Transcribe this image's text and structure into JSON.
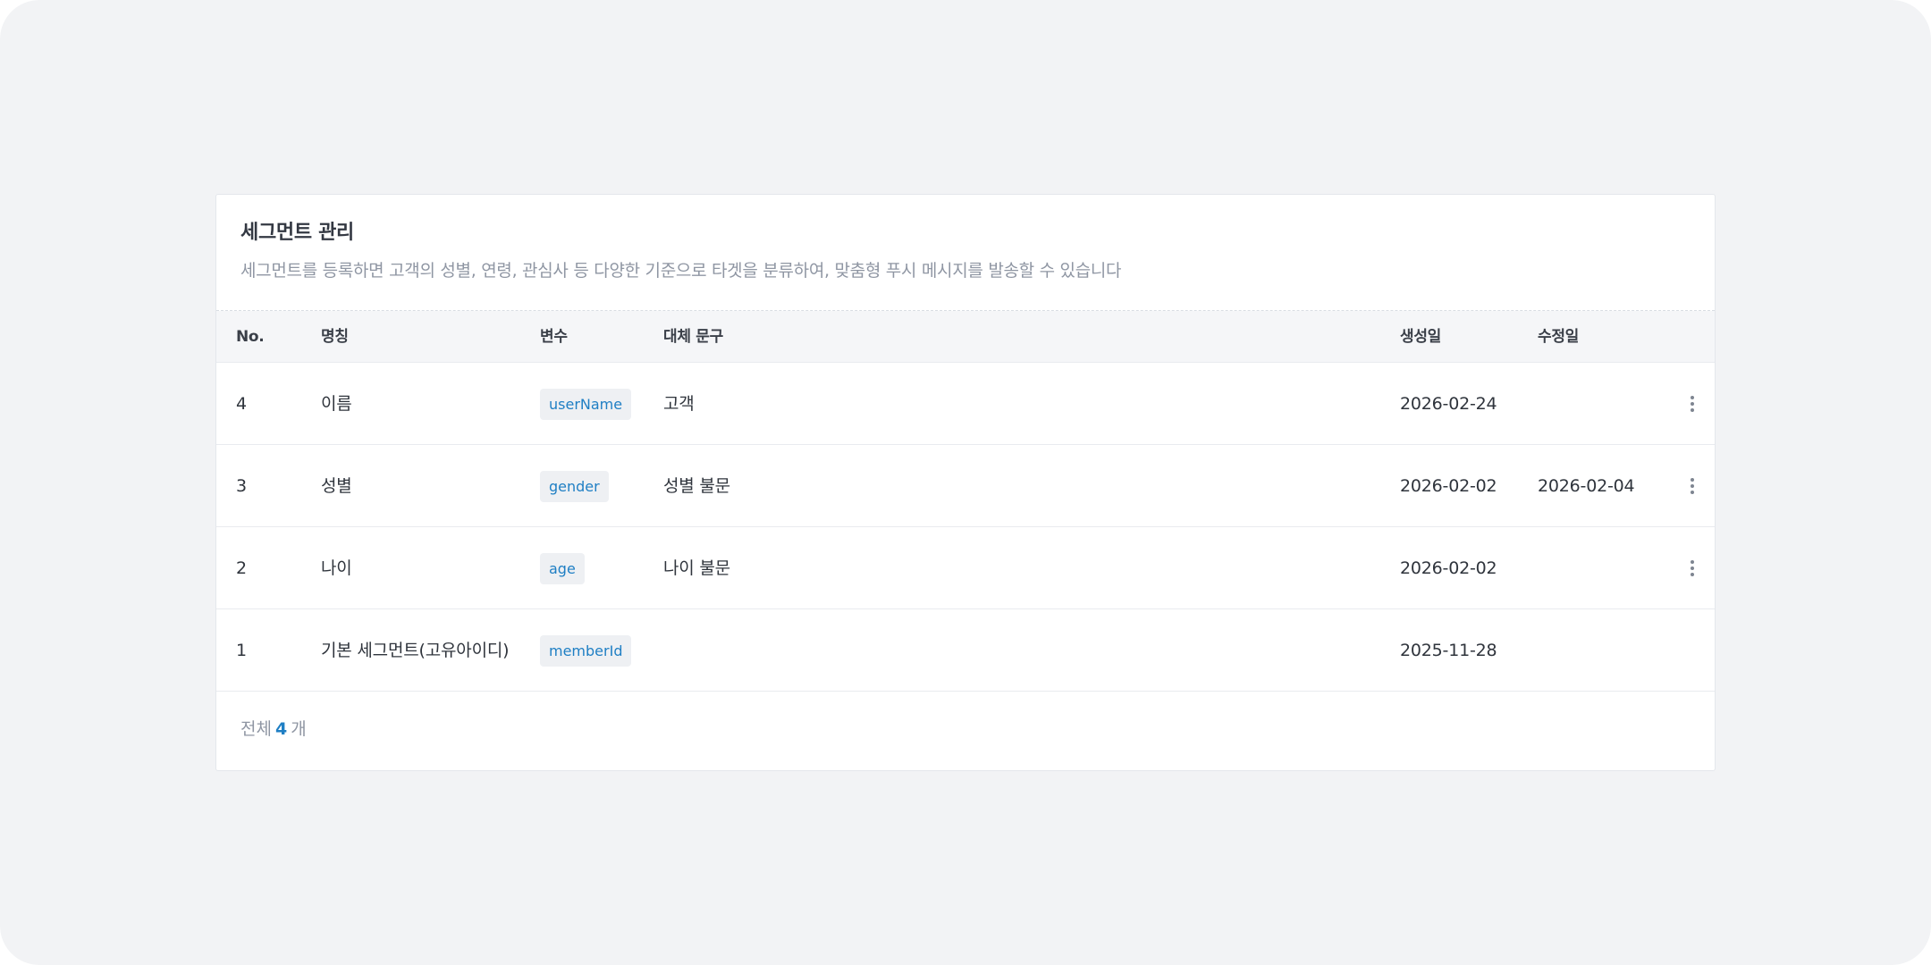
{
  "header": {
    "title": "세그먼트 관리",
    "description": "세그먼트를 등록하면 고객의 성별, 연령, 관심사 등 다양한 기준으로 타겟을 분류하여, 맞춤형 푸시 메시지를 발송할 수 있습니다"
  },
  "table": {
    "columns": {
      "no": "No.",
      "name": "명칭",
      "variable": "변수",
      "alt_text": "대체 문구",
      "created": "생성일",
      "modified": "수정일"
    },
    "rows": [
      {
        "no": "4",
        "name": "이름",
        "variable": "userName",
        "alt_text": "고객",
        "created": "2026-02-24",
        "modified": "",
        "has_menu": true
      },
      {
        "no": "3",
        "name": "성별",
        "variable": "gender",
        "alt_text": "성별 불문",
        "created": "2026-02-02",
        "modified": "2026-02-04",
        "has_menu": true
      },
      {
        "no": "2",
        "name": "나이",
        "variable": "age",
        "alt_text": "나이 불문",
        "created": "2026-02-02",
        "modified": "",
        "has_menu": true
      },
      {
        "no": "1",
        "name": "기본 세그먼트(고유아이디)",
        "variable": "memberId",
        "alt_text": "",
        "created": "2025-11-28",
        "modified": "",
        "has_menu": false
      }
    ]
  },
  "footer": {
    "total_prefix": "전체",
    "total_count": "4",
    "total_suffix": "개"
  },
  "colors": {
    "background": "#f2f3f5",
    "accent": "#1f7fc4",
    "muted_text": "#8f96a3"
  },
  "icons": {
    "row_menu": "more-vertical-icon"
  }
}
